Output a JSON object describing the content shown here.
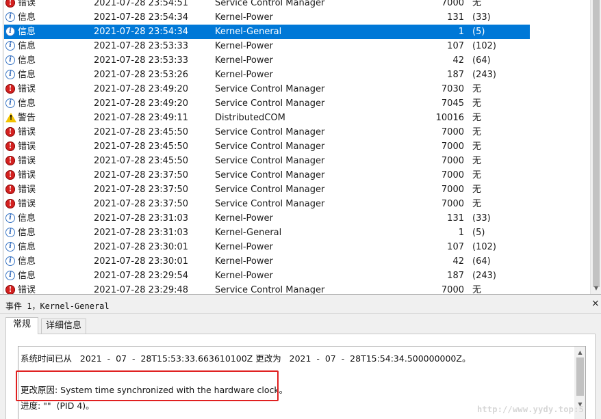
{
  "events": [
    {
      "level": "错误",
      "type": "error",
      "date": "2021-07-28 23:54:51",
      "source": "Service Control Manager",
      "id": "7000",
      "category": "无",
      "selected": false
    },
    {
      "level": "信息",
      "type": "info",
      "date": "2021-07-28 23:54:34",
      "source": "Kernel-Power",
      "id": "131",
      "category": "(33)",
      "selected": false
    },
    {
      "level": "信息",
      "type": "info",
      "date": "2021-07-28 23:54:34",
      "source": "Kernel-General",
      "id": "1",
      "category": "(5)",
      "selected": true
    },
    {
      "level": "信息",
      "type": "info",
      "date": "2021-07-28 23:53:33",
      "source": "Kernel-Power",
      "id": "107",
      "category": "(102)",
      "selected": false
    },
    {
      "level": "信息",
      "type": "info",
      "date": "2021-07-28 23:53:33",
      "source": "Kernel-Power",
      "id": "42",
      "category": "(64)",
      "selected": false
    },
    {
      "level": "信息",
      "type": "info",
      "date": "2021-07-28 23:53:26",
      "source": "Kernel-Power",
      "id": "187",
      "category": "(243)",
      "selected": false
    },
    {
      "level": "错误",
      "type": "error",
      "date": "2021-07-28 23:49:20",
      "source": "Service Control Manager",
      "id": "7030",
      "category": "无",
      "selected": false
    },
    {
      "level": "信息",
      "type": "info",
      "date": "2021-07-28 23:49:20",
      "source": "Service Control Manager",
      "id": "7045",
      "category": "无",
      "selected": false
    },
    {
      "level": "警告",
      "type": "warning",
      "date": "2021-07-28 23:49:11",
      "source": "DistributedCOM",
      "id": "10016",
      "category": "无",
      "selected": false
    },
    {
      "level": "错误",
      "type": "error",
      "date": "2021-07-28 23:45:50",
      "source": "Service Control Manager",
      "id": "7000",
      "category": "无",
      "selected": false
    },
    {
      "level": "错误",
      "type": "error",
      "date": "2021-07-28 23:45:50",
      "source": "Service Control Manager",
      "id": "7000",
      "category": "无",
      "selected": false
    },
    {
      "level": "错误",
      "type": "error",
      "date": "2021-07-28 23:45:50",
      "source": "Service Control Manager",
      "id": "7000",
      "category": "无",
      "selected": false
    },
    {
      "level": "错误",
      "type": "error",
      "date": "2021-07-28 23:37:50",
      "source": "Service Control Manager",
      "id": "7000",
      "category": "无",
      "selected": false
    },
    {
      "level": "错误",
      "type": "error",
      "date": "2021-07-28 23:37:50",
      "source": "Service Control Manager",
      "id": "7000",
      "category": "无",
      "selected": false
    },
    {
      "level": "错误",
      "type": "error",
      "date": "2021-07-28 23:37:50",
      "source": "Service Control Manager",
      "id": "7000",
      "category": "无",
      "selected": false
    },
    {
      "level": "信息",
      "type": "info",
      "date": "2021-07-28 23:31:03",
      "source": "Kernel-Power",
      "id": "131",
      "category": "(33)",
      "selected": false
    },
    {
      "level": "信息",
      "type": "info",
      "date": "2021-07-28 23:31:03",
      "source": "Kernel-General",
      "id": "1",
      "category": "(5)",
      "selected": false
    },
    {
      "level": "信息",
      "type": "info",
      "date": "2021-07-28 23:30:01",
      "source": "Kernel-Power",
      "id": "107",
      "category": "(102)",
      "selected": false
    },
    {
      "level": "信息",
      "type": "info",
      "date": "2021-07-28 23:30:01",
      "source": "Kernel-Power",
      "id": "42",
      "category": "(64)",
      "selected": false
    },
    {
      "level": "信息",
      "type": "info",
      "date": "2021-07-28 23:29:54",
      "source": "Kernel-Power",
      "id": "187",
      "category": "(243)",
      "selected": false
    },
    {
      "level": "错误",
      "type": "error",
      "date": "2021-07-28 23:29:48",
      "source": "Service Control Manager",
      "id": "7000",
      "category": "无",
      "selected": false
    }
  ],
  "detail": {
    "title": "事件 1，Kernel-General",
    "close_glyph": "×",
    "tabs": [
      {
        "label": "常规",
        "active": true
      },
      {
        "label": "详细信息",
        "active": false
      }
    ],
    "line1": "系统时间已从   2021  -  07  -  28T15:53:33.663610100Z 更改为   2021  -  07  -  28T15:54:34.500000000Z。",
    "line2": "更改原因: System time synchronized with the hardware clock。",
    "line3": "进度: \"\"  (PID 4)。"
  },
  "icons": {
    "error": "error-icon",
    "info": "info-icon",
    "warning": "warning-icon"
  },
  "colors": {
    "selection": "#0078d7",
    "highlight": "#e02020",
    "error": "#d4201f",
    "info": "#3a76c4",
    "warning": "#f2c200"
  },
  "watermark": "http://www.yydy.top:5"
}
